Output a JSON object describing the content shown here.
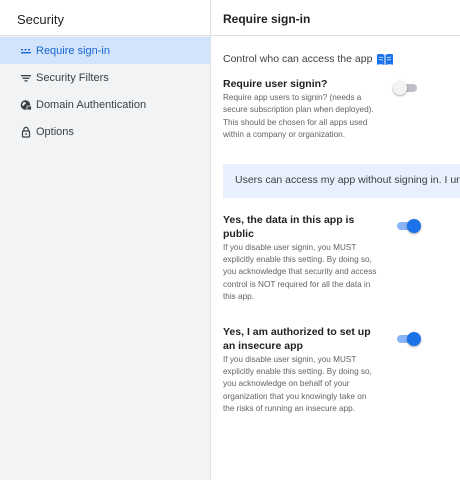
{
  "sidebar": {
    "title": "Security",
    "items": [
      {
        "label": "Require sign-in",
        "icon": "dotted-lines-icon",
        "active": true
      },
      {
        "label": "Security Filters",
        "icon": "filter-icon",
        "active": false
      },
      {
        "label": "Domain Authentication",
        "icon": "globe-lock-icon",
        "active": false
      },
      {
        "label": "Options",
        "icon": "lock-icon",
        "active": false
      }
    ]
  },
  "main": {
    "title": "Require sign-in",
    "control_text": "Control who can access the app",
    "control_icon": "book-icon",
    "require_signin": {
      "title": "Require user signin?",
      "description": "Require app users to signin? (needs a secure subscription plan when deployed). This should be chosen for all apps used within a company or organization.",
      "enabled": false
    },
    "banner_text": "Users can access my app without signing in. I un",
    "data_public": {
      "title": "Yes, the data in this app is public",
      "description": "If you disable user signin, you MUST explicitly enable this setting. By doing so, you acknowledge that security and access control is NOT required for all the data in this app.",
      "enabled": true
    },
    "insecure_app": {
      "title": "Yes, I am authorized to set up an insecure app",
      "description": "If you disable user signin, you MUST explicitly enable this setting. By doing so, you acknowledge on behalf of your organization that you knowingly take on the risks of running an insecure app.",
      "enabled": true
    }
  },
  "colors": {
    "accent": "#1a73e8",
    "active_bg": "#d2e3fc",
    "sidebar_bg": "#f1f3f4",
    "banner_bg": "#e8f0fe"
  }
}
